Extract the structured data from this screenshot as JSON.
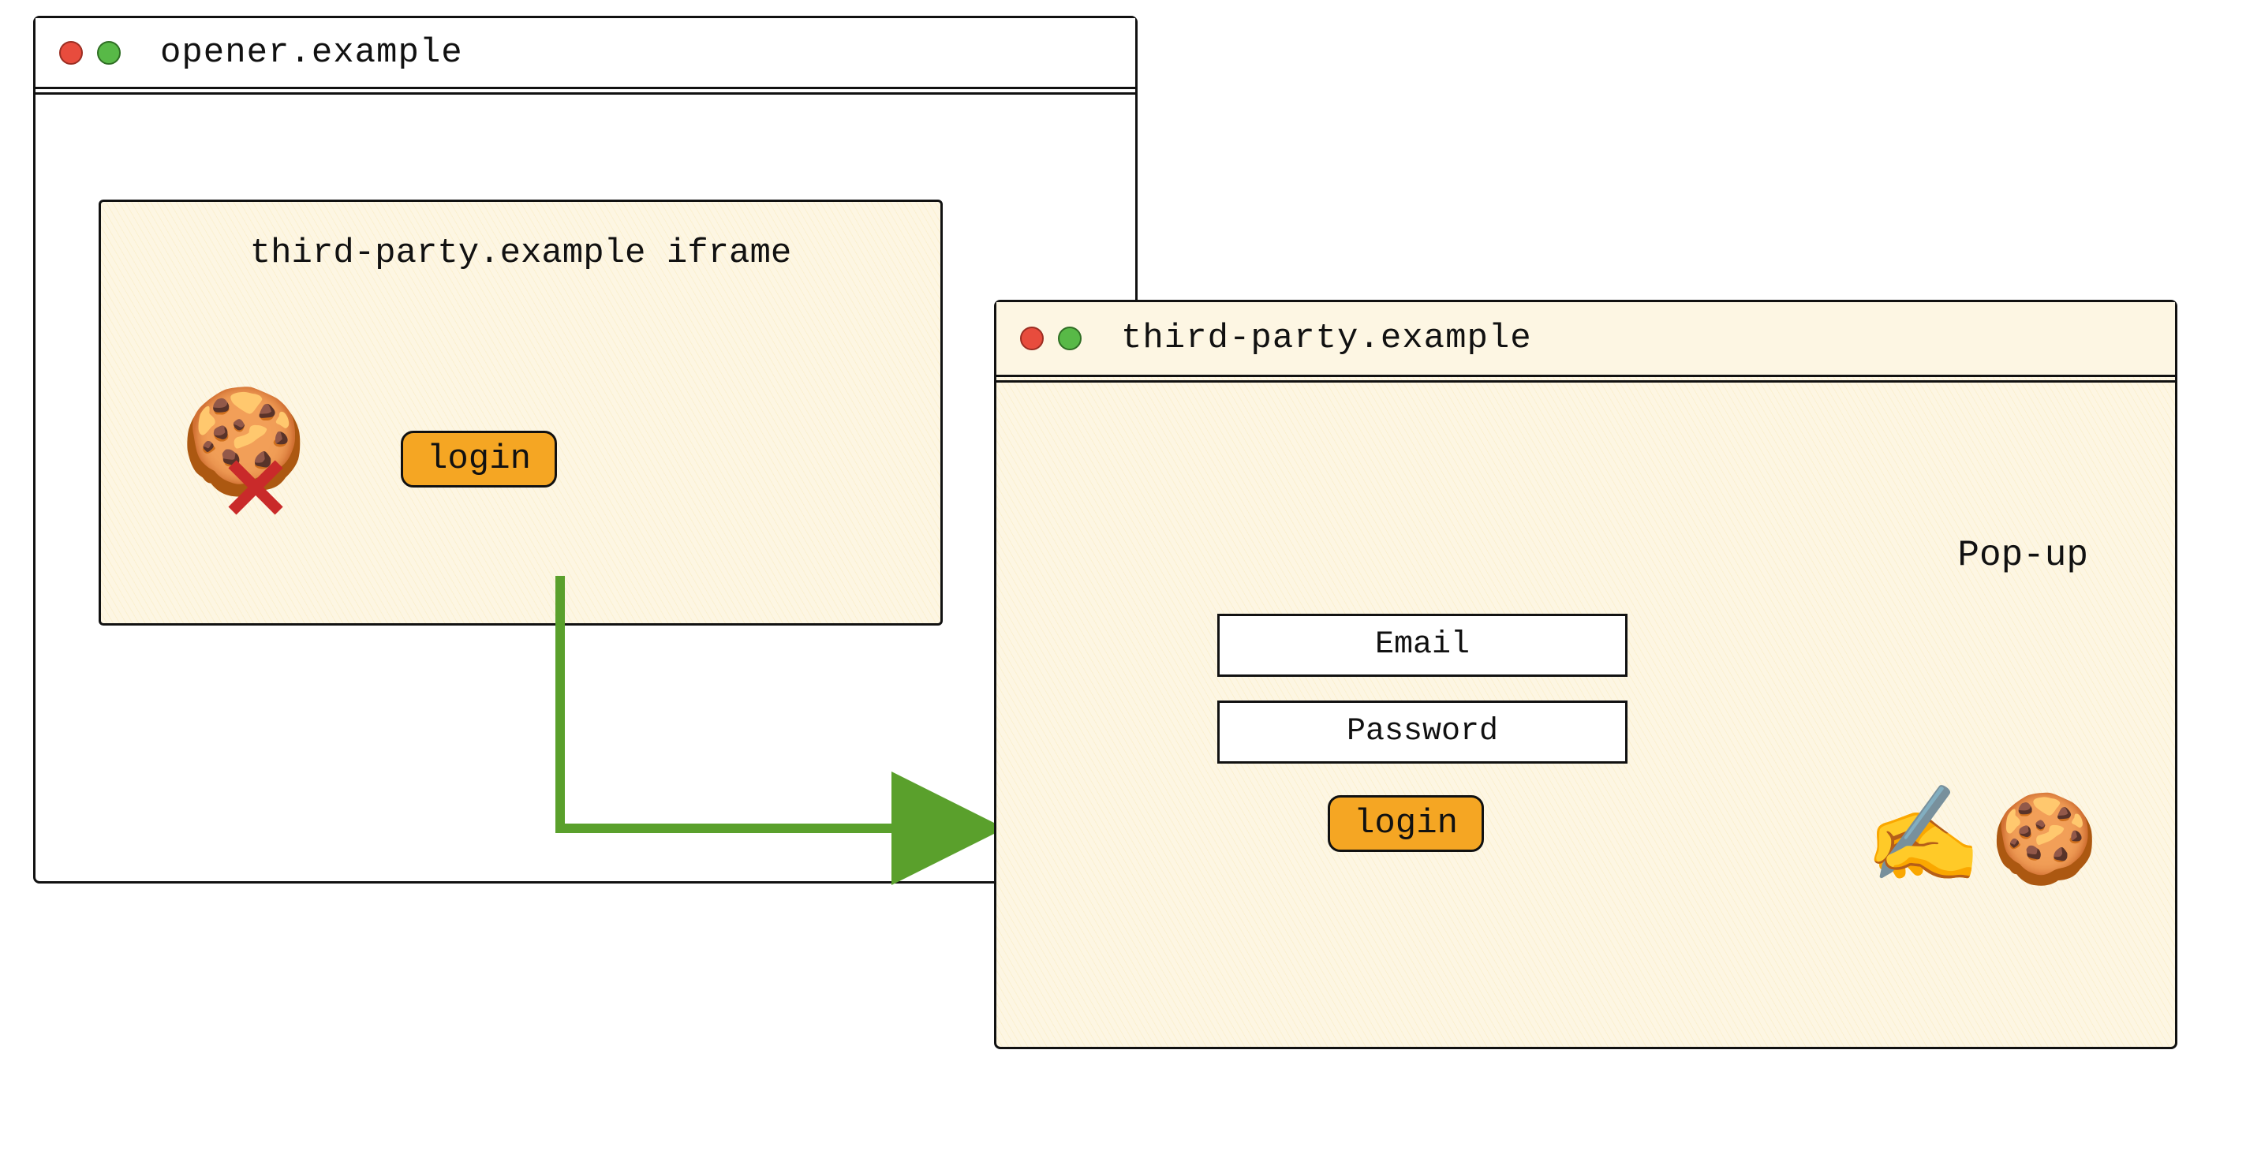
{
  "opener": {
    "title": "opener.example",
    "iframe": {
      "label": "third-party.example iframe",
      "login_label": "login",
      "cookie_icon": "🍪",
      "cross_icon": "✕"
    }
  },
  "popup": {
    "title": "third-party.example",
    "label": "Pop-up",
    "email_placeholder": "Email",
    "password_placeholder": "Password",
    "login_label": "login",
    "writing_icon": "✍️",
    "cookie_icon": "🍪"
  },
  "arrow": {
    "color": "#5aa02c"
  }
}
